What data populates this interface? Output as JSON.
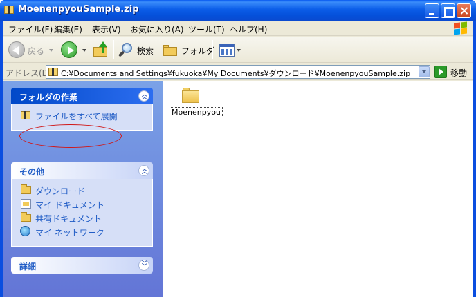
{
  "window": {
    "title": "MoenenpyouSample.zip"
  },
  "menu": [
    "ファイル(F)",
    "編集(E)",
    "表示(V)",
    "お気に入り(A)",
    "ツール(T)",
    "ヘルプ(H)"
  ],
  "toolbar": {
    "back": "戻る",
    "search": "検索",
    "folders": "フォルダ"
  },
  "address": {
    "label": "アドレス(D)",
    "value": "C:¥Documents and Settings¥fukuoka¥My Documents¥ダウンロード¥MoenenpyouSample.zip",
    "go": "移動"
  },
  "taskpane": {
    "folder_tasks": {
      "title": "フォルダの作業",
      "items": [
        "ファイルをすべて展開"
      ]
    },
    "other": {
      "title": "その他",
      "items": [
        "ダウンロード",
        "マイ ドキュメント",
        "共有ドキュメント",
        "マイ ネットワーク"
      ]
    },
    "details": {
      "title": "詳細"
    }
  },
  "files": [
    {
      "name": "Moenenpyou"
    }
  ]
}
